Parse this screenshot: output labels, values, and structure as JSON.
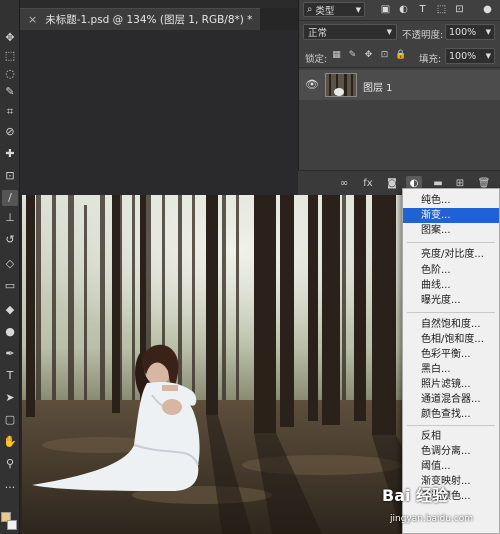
{
  "document": {
    "tab_title": "未标题-1.psd @ 134% (图层 1, RGB/8*) *",
    "close_glyph": "×"
  },
  "toolbar": {
    "icons": [
      "move-icon",
      "marquee-icon",
      "lasso-icon",
      "quick-select-icon",
      "crop-icon",
      "eyedropper-icon",
      "healing-icon",
      "brush-icon",
      "stamp-icon",
      "history-brush-icon",
      "eraser-icon",
      "gradient-icon",
      "blur-icon",
      "dodge-icon",
      "pen-icon",
      "type-icon",
      "path-select-icon",
      "shape-icon",
      "hand-icon",
      "zoom-icon",
      "more-icon"
    ],
    "foreground_color": "#e8c98a",
    "background_color": "#f2f2f2"
  },
  "layers_panel": {
    "filter_kind": "类型",
    "blend_mode": "正常",
    "opacity_label": "不透明度:",
    "opacity_value": "100%",
    "lock_label": "锁定:",
    "fill_label": "填充:",
    "fill_value": "100%",
    "layers": [
      {
        "name": "图层 1",
        "visible": true
      }
    ]
  },
  "adjustment_menu": {
    "groups": [
      [
        "纯色...",
        "渐变...",
        "图案..."
      ],
      [
        "亮度/对比度...",
        "色阶...",
        "曲线...",
        "曝光度..."
      ],
      [
        "自然饱和度...",
        "色相/饱和度...",
        "色彩平衡...",
        "黑白...",
        "照片滤镜...",
        "通道混合器...",
        "颜色查找..."
      ],
      [
        "反相",
        "色调分离...",
        "阈值...",
        "渐变映射...",
        "可选颜色..."
      ]
    ],
    "highlighted_item": "渐变..."
  },
  "watermark": {
    "logo": "Bai 经验",
    "url": "jingyan.baidu.com"
  },
  "colors": {
    "menu_highlight": "#1e62d6",
    "panel_bg": "#404040"
  }
}
